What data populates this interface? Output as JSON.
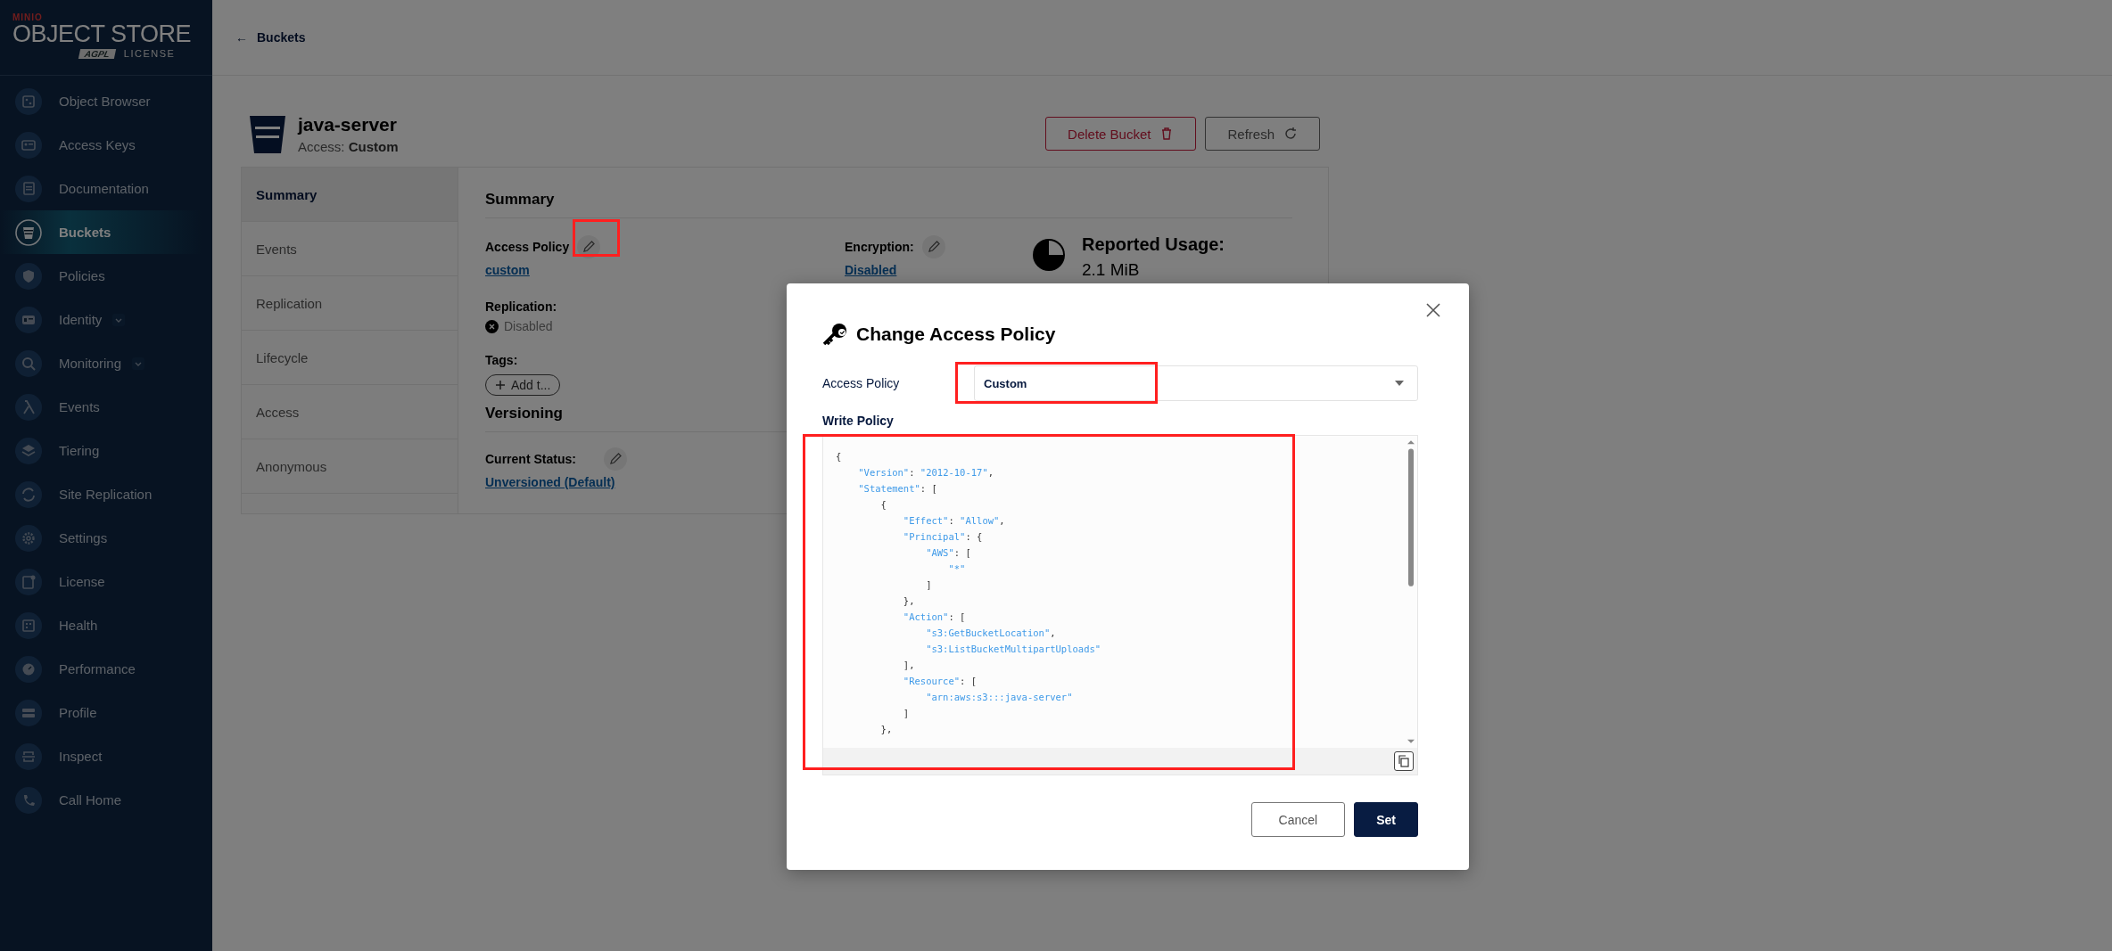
{
  "sidebar": {
    "logo": {
      "brand": "MINIO",
      "product": "OBJECT STORE",
      "badge": "AGPL",
      "license": "LICENSE"
    },
    "items": [
      {
        "label": "Object Browser",
        "selected": false,
        "expandable": false
      },
      {
        "label": "Access Keys",
        "selected": false,
        "expandable": false
      },
      {
        "label": "Documentation",
        "selected": false,
        "expandable": false
      },
      {
        "label": "Buckets",
        "selected": true,
        "expandable": false
      },
      {
        "label": "Policies",
        "selected": false,
        "expandable": false
      },
      {
        "label": "Identity",
        "selected": false,
        "expandable": true
      },
      {
        "label": "Monitoring",
        "selected": false,
        "expandable": true
      },
      {
        "label": "Events",
        "selected": false,
        "expandable": false
      },
      {
        "label": "Tiering",
        "selected": false,
        "expandable": false
      },
      {
        "label": "Site Replication",
        "selected": false,
        "expandable": false
      },
      {
        "label": "Settings",
        "selected": false,
        "expandable": false
      },
      {
        "label": "License",
        "selected": false,
        "expandable": false
      },
      {
        "label": "Health",
        "selected": false,
        "expandable": false
      },
      {
        "label": "Performance",
        "selected": false,
        "expandable": false
      },
      {
        "label": "Profile",
        "selected": false,
        "expandable": false
      },
      {
        "label": "Inspect",
        "selected": false,
        "expandable": false
      },
      {
        "label": "Call Home",
        "selected": false,
        "expandable": false
      }
    ]
  },
  "top_bar": {
    "back_arrow": "←",
    "back_link": "Buckets"
  },
  "bucket": {
    "name": "java-server",
    "access_label": "Access:",
    "access_value": "Custom",
    "buttons": [
      {
        "label": "Delete Bucket",
        "kind": "danger"
      },
      {
        "label": "Refresh",
        "kind": "default"
      }
    ]
  },
  "tabs": [
    {
      "label": "Summary",
      "selected": true
    },
    {
      "label": "Events",
      "selected": false
    },
    {
      "label": "Replication",
      "selected": false
    },
    {
      "label": "Lifecycle",
      "selected": false
    },
    {
      "label": "Access",
      "selected": false
    },
    {
      "label": "Anonymous",
      "selected": false
    }
  ],
  "summary": {
    "title": "Summary",
    "access_policy": {
      "label": "Access Policy",
      "value": "custom"
    },
    "encryption": {
      "label": "Encryption:",
      "value": "Disabled"
    },
    "reported_usage": {
      "label": "Reported Usage:",
      "value": "2.1 MiB"
    },
    "replication": {
      "label": "Replication:",
      "value": "Disabled"
    },
    "tags": {
      "label": "Tags:",
      "add_button": "Add t..."
    },
    "versioning": {
      "title": "Versioning",
      "label": "Current Status:",
      "value": "Unversioned (Default)"
    }
  },
  "dialog": {
    "title": "Change Access Policy",
    "field_label": "Access Policy",
    "select_value": "Custom",
    "editor_label": "Write Policy",
    "code_lines": [
      "{",
      "    \"Version\": \"2012-10-17\",",
      "    \"Statement\": [",
      "        {",
      "            \"Effect\": \"Allow\",",
      "            \"Principal\": {",
      "                \"AWS\": [",
      "                    \"*\"",
      "                ]",
      "            },",
      "            \"Action\": [",
      "                \"s3:GetBucketLocation\",",
      "                \"s3:ListBucketMultipartUploads\"",
      "            ],",
      "            \"Resource\": [",
      "                \"arn:aws:s3:::java-server\"",
      "            ]",
      "        },"
    ],
    "buttons": [
      {
        "label": "Cancel",
        "kind": "secondary"
      },
      {
        "label": "Set",
        "kind": "primary"
      }
    ]
  }
}
